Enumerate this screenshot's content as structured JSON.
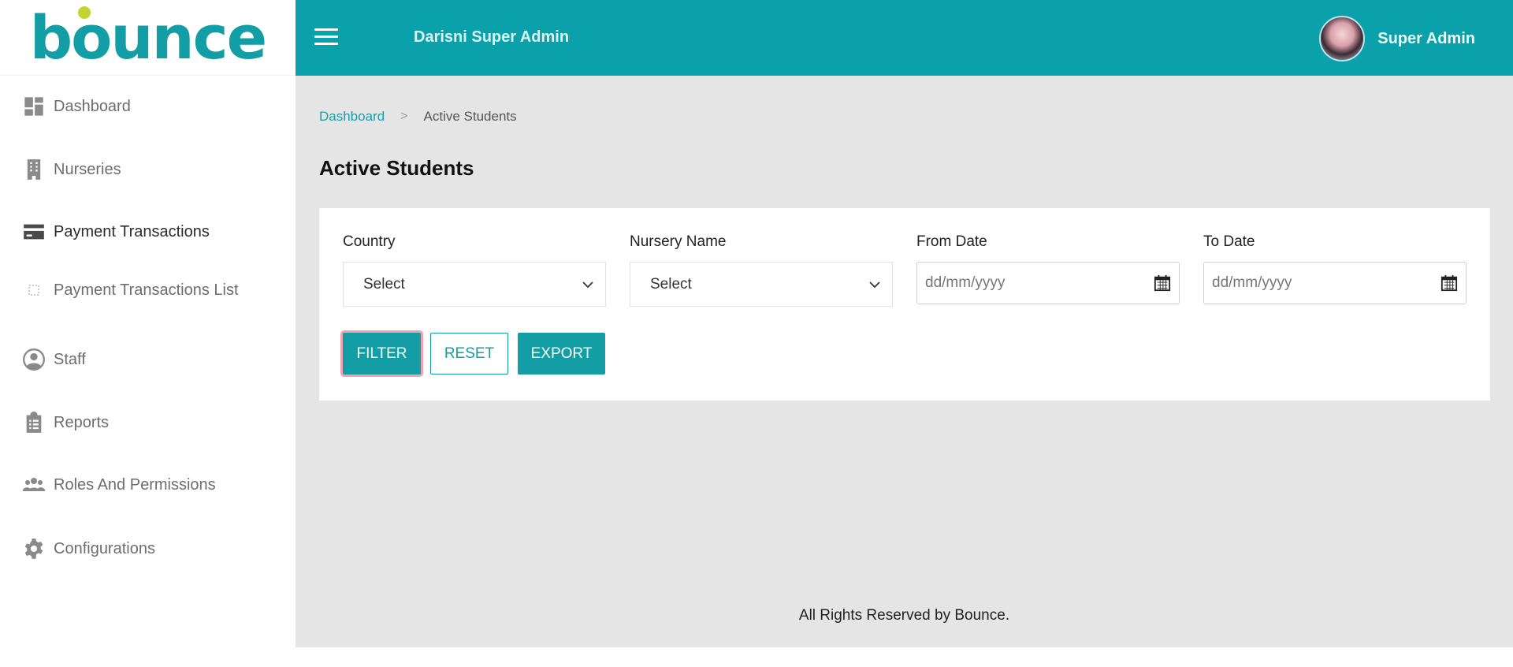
{
  "brand": {
    "logo_text": "bounce",
    "accent_color": "#0ba1ab",
    "logo_dot_color": "#c3d431"
  },
  "header": {
    "title": "Darisni Super Admin",
    "user_name": "Super Admin"
  },
  "sidebar": {
    "items": [
      {
        "label": "Dashboard",
        "icon": "dashboard-icon"
      },
      {
        "label": "Nurseries",
        "icon": "building-icon"
      },
      {
        "label": "Payment Transactions",
        "icon": "credit-card-icon"
      },
      {
        "label": "Payment Transactions List",
        "icon": "square-outline-icon"
      },
      {
        "label": "Staff",
        "icon": "user-circle-icon"
      },
      {
        "label": "Reports",
        "icon": "clipboard-icon"
      },
      {
        "label": "Roles And Permissions",
        "icon": "users-icon"
      },
      {
        "label": "Configurations",
        "icon": "gear-icon"
      }
    ]
  },
  "breadcrumb": {
    "home": "Dashboard",
    "separator": ">",
    "current": "Active Students"
  },
  "page": {
    "title": "Active Students"
  },
  "filters": {
    "country": {
      "label": "Country",
      "value": "Select"
    },
    "nursery": {
      "label": "Nursery Name",
      "value": "Select"
    },
    "from_date": {
      "label": "From Date",
      "placeholder": "dd/mm/yyyy"
    },
    "to_date": {
      "label": "To Date",
      "placeholder": "dd/mm/yyyy"
    }
  },
  "buttons": {
    "filter": "FILTER",
    "reset": "RESET",
    "export": "EXPORT"
  },
  "footer": {
    "text": "All Rights Reserved by Bounce."
  }
}
